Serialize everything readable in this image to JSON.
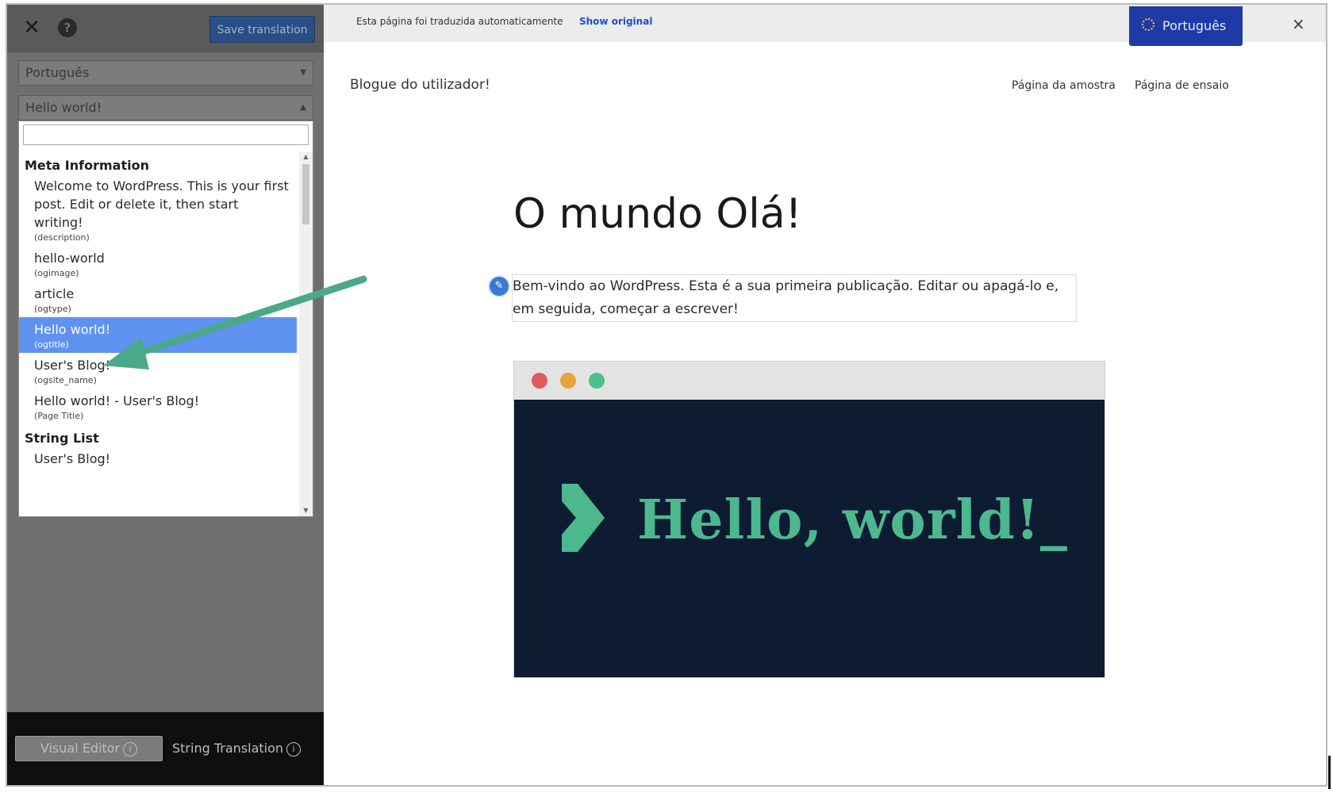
{
  "sidebar": {
    "close_icon": "close-icon",
    "help_icon": "help-icon",
    "save_label": "Save translation",
    "language_select": "Português",
    "string_select": "Hello world!",
    "dropdown": {
      "group_meta": "Meta Information",
      "items": [
        {
          "text": "Welcome to WordPress. This is your first post. Edit or delete it, then start writing!",
          "key": "(description)"
        },
        {
          "text": "hello-world",
          "key": "(ogimage)"
        },
        {
          "text": "article",
          "key": "(ogtype)"
        },
        {
          "text": "Hello world!",
          "key": "(ogtitle)",
          "selected": true
        },
        {
          "text": "User's Blog!",
          "key": "(ogsite_name)"
        },
        {
          "text": "Hello world! - User's Blog!",
          "key": "(Page Title)"
        }
      ],
      "group_strings": "String List",
      "partial_item": "User's Blog!"
    },
    "footer": {
      "visual_editor": "Visual Editor",
      "string_translation": "String Translation",
      "info_glyph": "i"
    }
  },
  "translate_bar": {
    "message": "Esta página foi traduzida automaticamente",
    "show_original": "Show original",
    "language": "Português",
    "close": "×"
  },
  "site": {
    "title": "Blogue do utilizador!",
    "nav": [
      "Página da amostra",
      "Página de ensaio"
    ],
    "post_title": "O mundo Olá!",
    "excerpt": "Bem-vindo ao WordPress. Esta é a sua primeira publicação. Editar ou apagá-lo e, em seguida, começar a escrever!",
    "image_text": "Hello, world!_"
  },
  "colors": {
    "save_button": "#2a4f86",
    "selected_item": "#5f92f0",
    "arrow": "#4aa98a",
    "language_button": "#1e3aa6",
    "image_bg": "#0d1b33",
    "image_text": "#4cb88d"
  }
}
